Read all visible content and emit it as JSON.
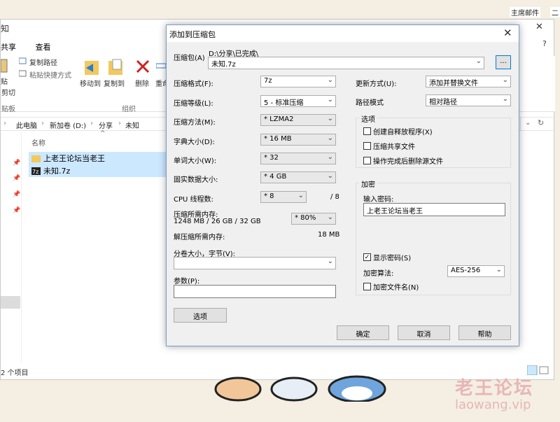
{
  "desktop": {
    "icon1_label": "主席邮件",
    "icon2_label": "二"
  },
  "explorer": {
    "title_fragment": "知",
    "tabs": [
      "共享",
      "查看"
    ],
    "ribbon": {
      "copy_path": "复制路径",
      "paste_shortcut": "粘贴快捷方式",
      "paste": "贴",
      "cut": "剪切",
      "clipboard_group": "贴板",
      "move_to": "移动到",
      "copy_to": "复制到",
      "delete": "删除",
      "rename": "重命",
      "organize_group": "组织"
    },
    "breadcrumb": [
      "此电脑",
      "新加卷 (D:)",
      "分享",
      "未知"
    ],
    "column_name": "名称",
    "files": [
      {
        "name": "上老王论坛当老王",
        "icon": "folder-icon"
      },
      {
        "name": "未知.7z",
        "icon": "archive-7z-icon"
      }
    ],
    "status": "2 个项目"
  },
  "watermark": {
    "line1": "老王论坛",
    "line2": "laowang.vip"
  },
  "dialog": {
    "title": "添加到压缩包",
    "archive_label": "压缩包(A)",
    "archive_path": "D:\\分享\\已完成\\",
    "archive_name": "未知.7z",
    "browse_label": "...",
    "format_label": "压缩格式(F):",
    "format_value": "7z",
    "level_label": "压缩等级(L):",
    "level_value": "5 - 标准压缩",
    "method_label": "压缩方法(M):",
    "method_value": "* LZMA2",
    "dict_label": "字典大小(D):",
    "dict_value": "* 16 MB",
    "word_label": "单词大小(W):",
    "word_value": "* 32",
    "solid_label": "固实数据大小:",
    "solid_value": "* 4 GB",
    "cpu_label": "CPU 线程数:",
    "cpu_value": "* 8",
    "cpu_max": "/ 8",
    "mem_label": "压缩所需内存:",
    "mem_detail": "1248 MB / 26 GB / 32 GB",
    "mem_pct": "* 80%",
    "decomp_label": "解压缩所需内存:",
    "decomp_value": "18 MB",
    "volume_label": "分卷大小，字节(V):",
    "volume_value": "",
    "params_label": "参数(P):",
    "params_value": "",
    "options_button": "选项",
    "update_label": "更新方式(U):",
    "update_value": "添加并替换文件",
    "path_label": "路径模式",
    "path_value": "相对路径",
    "options_group": "选项",
    "opt_sfx": "创建自释放程序(X)",
    "opt_shared": "压缩共享文件",
    "opt_delete": "操作完成后删除源文件",
    "encrypt_group": "加密",
    "password_label": "输入密码:",
    "password_value": "上老王论坛当老王",
    "show_password": "显示密码(S)",
    "algo_label": "加密算法:",
    "algo_value": "AES-256",
    "encrypt_names": "加密文件名(N)",
    "ok": "确定",
    "cancel": "取消",
    "help": "帮助"
  }
}
